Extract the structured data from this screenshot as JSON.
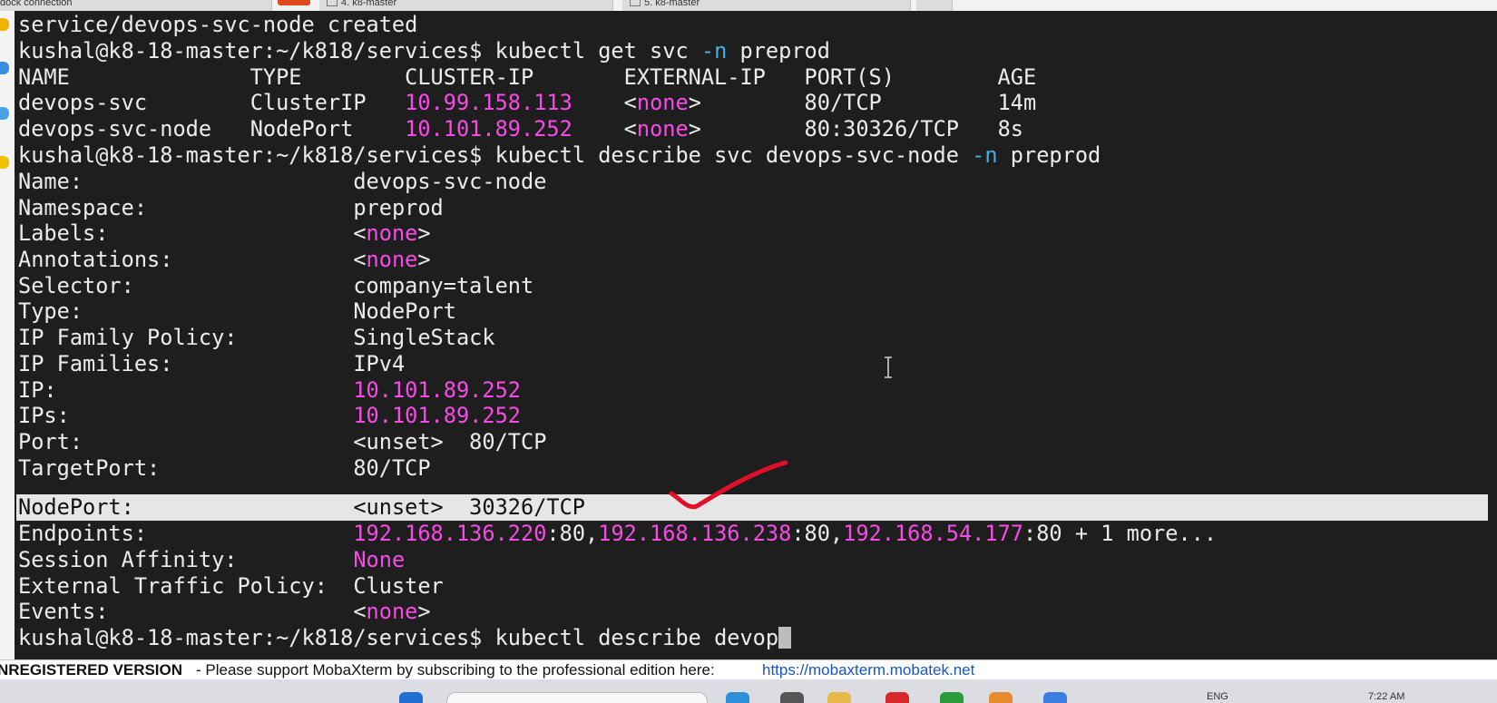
{
  "window_tabs": [
    {
      "label": "dock connection"
    },
    {
      "label": "4. k8-master"
    },
    {
      "label": "5. k8-master"
    }
  ],
  "terminal": {
    "prompt": "kushal@k8-18-master:~/k818/services$",
    "line_created": "service/devops-svc-node created",
    "cmd1": {
      "p1": "kubectl get svc ",
      "flag": "-n",
      "p2": " preprod"
    },
    "table": {
      "header": "NAME              TYPE        CLUSTER-IP       EXTERNAL-IP   PORT(S)        AGE",
      "rows": [
        {
          "name": "devops-svc        ",
          "type": "ClusterIP   ",
          "cluster_ip": "10.99.158.113",
          "gap": "    <",
          "external": "none",
          "rest": ">        80/TCP         14m"
        },
        {
          "name": "devops-svc-node   ",
          "type": "NodePort    ",
          "cluster_ip": "10.101.89.252",
          "gap": "    <",
          "external": "none",
          "rest": ">        80:30326/TCP   8s"
        }
      ]
    },
    "cmd2": {
      "p1": "kubectl describe svc devops-svc-node ",
      "flag": "-n",
      "p2": " preprod"
    },
    "describe": {
      "name": {
        "label": "Name:                     ",
        "value": "devops-svc-node"
      },
      "namespace": {
        "label": "Namespace:                ",
        "value": "preprod"
      },
      "labels": {
        "label": "Labels:                   <",
        "value": "none",
        "end": ">"
      },
      "annotations": {
        "label": "Annotations:              <",
        "value": "none",
        "end": ">"
      },
      "selector": {
        "label": "Selector:                 ",
        "value": "company=talent"
      },
      "type": {
        "label": "Type:                     ",
        "value": "NodePort"
      },
      "ip_family_policy": {
        "label": "IP Family Policy:         ",
        "value": "SingleStack"
      },
      "ip_families": {
        "label": "IP Families:              ",
        "value": "IPv4"
      },
      "ip": {
        "label": "IP:                       ",
        "value": "10.101.89.252"
      },
      "ips": {
        "label": "IPs:                      ",
        "value": "10.101.89.252"
      },
      "port": {
        "label": "Port:                     ",
        "value": "<unset>  80/TCP"
      },
      "target_port": {
        "label": "TargetPort:               ",
        "value": "80/TCP"
      },
      "node_port": {
        "label": "NodePort:                 ",
        "value": "<unset>  30326/TCP"
      },
      "endpoints": {
        "label": "Endpoints:                ",
        "ep1": "192.168.136.220",
        "s1": ":80,",
        "ep2": "192.168.136.238",
        "s2": ":80,",
        "ep3": "192.168.54.177",
        "s3": ":80 + 1 more..."
      },
      "session_affinity": {
        "label": "Session Affinity:         ",
        "value": "None"
      },
      "external_traffic_policy": {
        "label": "External Traffic Policy:  ",
        "value": "Cluster"
      },
      "events": {
        "label": "Events:                   <",
        "value": "none",
        "end": ">"
      }
    },
    "current_input": "kubectl describe devop"
  },
  "status_bar": {
    "warning": "NREGISTERED VERSION",
    "message": "-  Please support MobaXterm by subscribing to the professional edition here:",
    "link": "https://mobaxterm.mobatek.net"
  },
  "taskbar": {
    "lang": "ENG",
    "time": "7:22 AM"
  },
  "colors": {
    "terminal_bg": "#1e1e1e",
    "text": "#ececec",
    "ip_magenta": "#f84ae6",
    "flag_cyan": "#3fb2e8",
    "annotation_red": "#e0102a",
    "link_blue": "#1a56c8"
  }
}
